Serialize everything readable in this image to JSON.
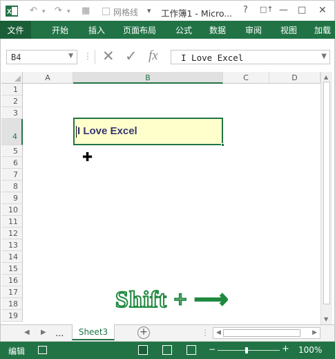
{
  "app": {
    "title": "工作簿1 - Micro...",
    "brand_color": "#217346"
  },
  "quick_access": {
    "gridlines_label": "网格线"
  },
  "window_buttons": [
    "?",
    "□↑",
    "—",
    "□"
  ],
  "ribbon": {
    "tabs": [
      {
        "label": "文件",
        "active": true
      },
      {
        "label": "开始"
      },
      {
        "label": "插入"
      },
      {
        "label": "页面布局"
      },
      {
        "label": "公式"
      },
      {
        "label": "数据"
      },
      {
        "label": "审阅"
      },
      {
        "label": "视图"
      },
      {
        "label": "加载"
      }
    ]
  },
  "formula_bar": {
    "name_box": "B4",
    "formula": "I Love Excel",
    "fx_label": "fx"
  },
  "grid": {
    "columns": [
      "A",
      "B",
      "C",
      "D"
    ],
    "selected_column": "B",
    "rows": [
      "1",
      "2",
      "3",
      "4",
      "5",
      "6",
      "7",
      "8",
      "9",
      "10",
      "11",
      "12",
      "13",
      "14",
      "15",
      "16",
      "17",
      "18",
      "19"
    ],
    "selected_row": "4",
    "active_cell": {
      "ref": "B4",
      "value": "I Love Excel"
    }
  },
  "overlay": {
    "shortcut_label": "Shift + ⟶"
  },
  "sheet_tabs": {
    "more_label": "...",
    "active_sheet": "Sheet3"
  },
  "status_bar": {
    "mode": "编辑",
    "zoom": "100%"
  }
}
